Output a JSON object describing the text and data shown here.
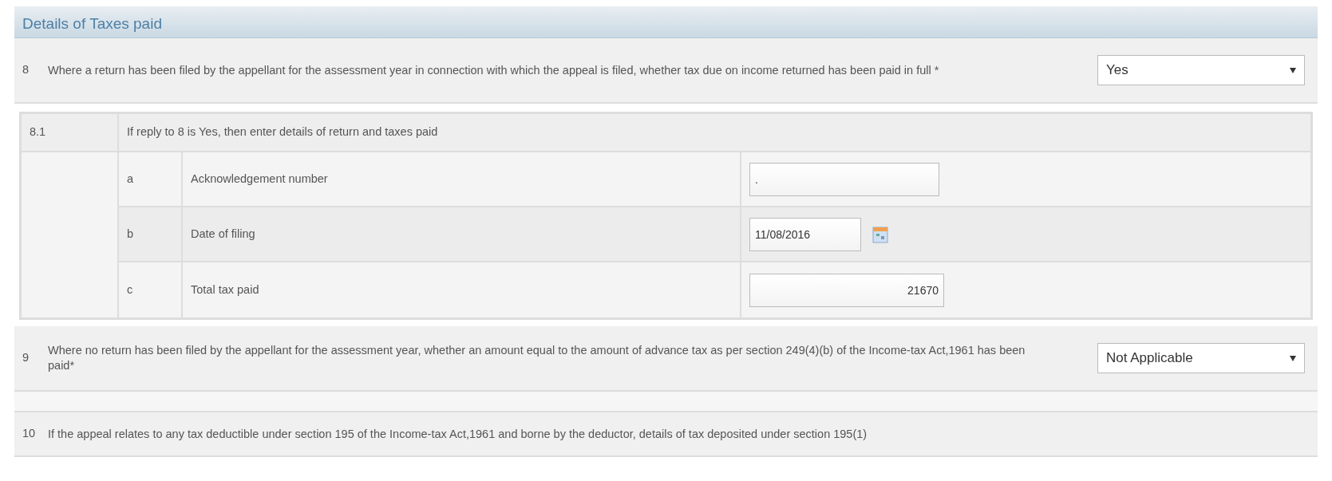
{
  "section_title": "Details of Taxes paid",
  "questions": [
    {
      "number": "8",
      "text": "Where a return has been filed by the appellant for the assessment year in connection with which the appeal is filed, whether tax due on income returned has been paid in full *",
      "answer": "Yes"
    }
  ],
  "sub_question": {
    "number": "8.1",
    "text": "If reply to 8 is Yes, then enter details of return and taxes paid",
    "items": [
      {
        "letter": "a",
        "label": "Acknowledgement number",
        "kind": "text",
        "value": "."
      },
      {
        "letter": "b",
        "label": "Date of filing",
        "kind": "date",
        "value": "11/08/2016"
      },
      {
        "letter": "c",
        "label": "Total tax paid",
        "kind": "amount",
        "value": "21670"
      }
    ]
  },
  "question_9": {
    "number": "9",
    "text": "Where no return has been filed by the appellant for the assessment year, whether an amount equal to the amount of advance tax as per section 249(4)(b) of the Income-tax Act,1961 has been paid*",
    "answer": "Not Applicable"
  },
  "question_10": {
    "number": "10",
    "text": "If the appeal relates to any tax deductible under section 195 of the Income-tax Act,1961 and borne by the deductor, details of tax deposited under section 195(1)"
  }
}
